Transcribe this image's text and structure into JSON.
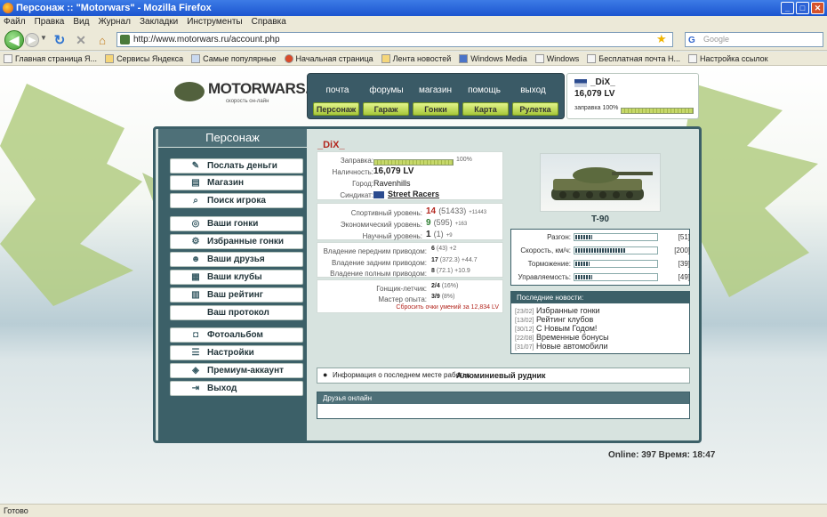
{
  "window": {
    "title": "Персонаж :: \"Motorwars\" - Mozilla Firefox"
  },
  "menu": [
    "Файл",
    "Правка",
    "Вид",
    "Журнал",
    "Закладки",
    "Инструменты",
    "Справка"
  ],
  "url": "http://www.motorwars.ru/account.php",
  "search_placeholder": "Google",
  "bookmarks": [
    "Главная страница Я...",
    "Сервисы Яндекса",
    "Самые популярные",
    "Начальная страница",
    "Лента новостей",
    "Windows Media",
    "Windows",
    "Бесплатная почта Н...",
    "Настройка ссылок"
  ],
  "site": {
    "logo": "MOTORWARS.RU",
    "logo_sub": "скорость он-лайн",
    "top_links": [
      "почта",
      "форумы",
      "магазин",
      "помощь",
      "выход"
    ],
    "main_buttons": [
      "Персонаж",
      "Гараж",
      "Гонки",
      "Карта",
      "Рулетка"
    ],
    "player": {
      "name": "_DiX_",
      "money": "16,079 LV",
      "fuel_label": "заправка 100%",
      "fuel_pct": 100
    }
  },
  "sidebar": {
    "title": "Персонаж",
    "items": [
      {
        "label": "Послать деньги",
        "icon": "money-icon"
      },
      {
        "label": "Магазин",
        "icon": "shop-icon"
      },
      {
        "label": "Поиск игрока",
        "icon": "search-icon"
      },
      {
        "label": "Ваши гонки",
        "icon": "wheel-icon"
      },
      {
        "label": "Избранные гонки",
        "icon": "gears-icon"
      },
      {
        "label": "Ваши друзья",
        "icon": "friends-icon"
      },
      {
        "label": "Ваши клубы",
        "icon": "clubs-icon"
      },
      {
        "label": "Ваш рейтинг",
        "icon": "chart-icon"
      },
      {
        "label": "Ваш протокол",
        "icon": ""
      },
      {
        "label": "Фотоальбом",
        "icon": "camera-icon"
      },
      {
        "label": "Настройки",
        "icon": "settings-icon"
      },
      {
        "label": "Премиум-аккаунт",
        "icon": "diamond-icon"
      },
      {
        "label": "Выход",
        "icon": "exit-icon"
      }
    ]
  },
  "profile": {
    "name": "_DiX_",
    "fuel_label": "Заправка:",
    "fuel_pct": 100,
    "fuel_text": "100%",
    "cash_label": "Наличность:",
    "cash": "16,079 LV",
    "city_label": "Город:",
    "city": "Ravenhills",
    "syndicate_label": "Синдикат:",
    "syndicate": "Street Racers",
    "levels": [
      {
        "label": "Спортивный уровень:",
        "level": "14",
        "points": "(51433)",
        "delta": "+11443",
        "color": "#b3261e"
      },
      {
        "label": "Экономический уровень:",
        "level": "9",
        "points": "(595)",
        "delta": "+163",
        "color": "#2e7d32"
      },
      {
        "label": "Научный уровень:",
        "level": "1",
        "points": "(1)",
        "delta": "+9",
        "color": "#222"
      }
    ],
    "drives": [
      {
        "label": "Владение передним приводом:",
        "value": "6",
        "extra": "(43) +2"
      },
      {
        "label": "Владение задним приводом:",
        "value": "17",
        "extra": "(372.3) +44.7"
      },
      {
        "label": "Владение полным приводом:",
        "value": "8",
        "extra": "(72.1) +10.9"
      }
    ],
    "ranks": [
      {
        "label": "Гонщик-летчик:",
        "value": "2/4",
        "extra": "(16%)"
      },
      {
        "label": "Мастер опыта:",
        "value": "3/9",
        "extra": "(8%)"
      }
    ],
    "reset_link": "Сбросить очки умений за 12,834 LV"
  },
  "car": {
    "name": "T-90",
    "stats": [
      {
        "label": "Разгон:",
        "value": 51,
        "text": "[51]"
      },
      {
        "label": "Скорость, км/ч:",
        "value": 200,
        "text": "[200]"
      },
      {
        "label": "Торможение:",
        "value": 39,
        "text": "[39]"
      },
      {
        "label": "Управляемость:",
        "value": 49,
        "text": "[49]"
      }
    ]
  },
  "news": {
    "title": "Последние новости:",
    "items": [
      {
        "date": "[23/02]",
        "text": "Избранные гонки"
      },
      {
        "date": "[13/02]",
        "text": "Рейтинг клубов"
      },
      {
        "date": "[30/12]",
        "text": "С Новым Годом!"
      },
      {
        "date": "[22/08]",
        "text": "Временные бонусы"
      },
      {
        "date": "[31/07]",
        "text": "Новые автомобили"
      }
    ]
  },
  "work": {
    "label": "Информация о последнем месте работы:",
    "place": "Алюминиевый рудник"
  },
  "friends": {
    "title": "Друзья онлайн"
  },
  "footer": {
    "text": "Online: 397  Время: 18:47"
  },
  "status": "Готово"
}
